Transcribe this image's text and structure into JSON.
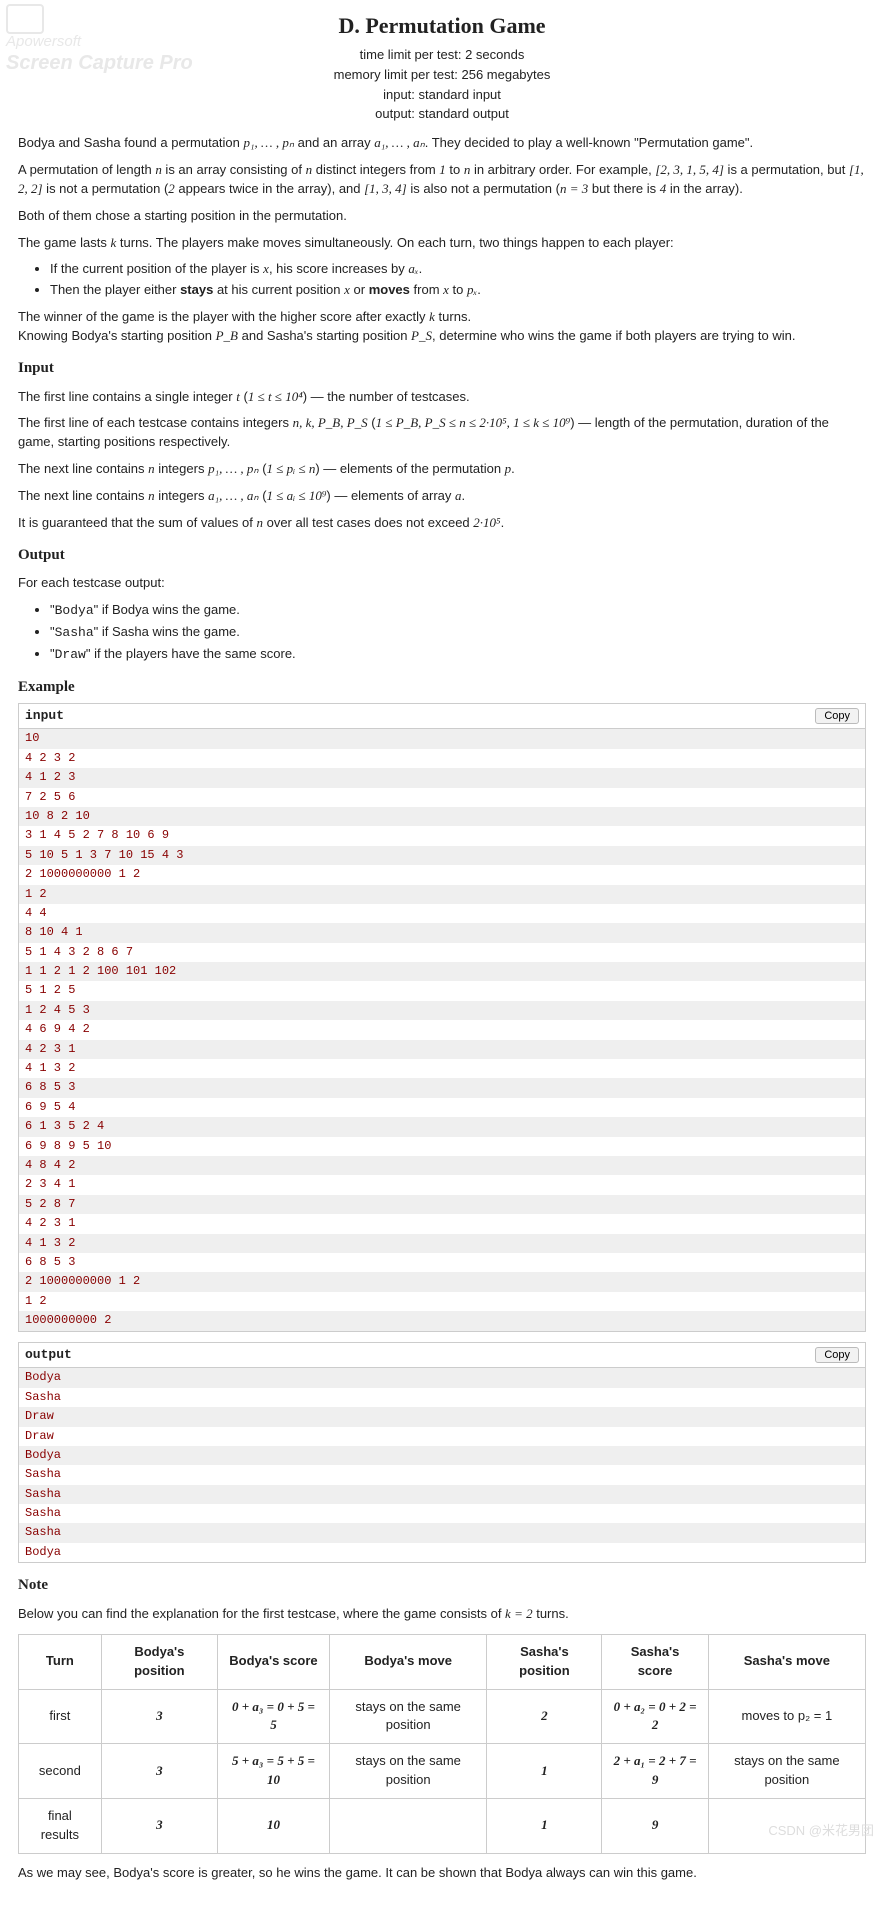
{
  "watermark": {
    "brand": "Apowersoft",
    "product": "Screen Capture Pro"
  },
  "footer": "CSDN @米花男团",
  "title": "D. Permutation Game",
  "meta": {
    "time": "time limit per test: 2 seconds",
    "memory": "memory limit per test: 256 megabytes",
    "input": "input: standard input",
    "output": "output: standard output"
  },
  "body": {
    "p1a": "Bodya and Sasha found a permutation ",
    "p1_m1": "p₁, … , pₙ",
    "p1b": " and an array ",
    "p1_m2": "a₁, … , aₙ",
    "p1c": ". They decided to play a well-known \"Permutation game\".",
    "p2a": "A permutation of length ",
    "p2_n": "n",
    "p2b": " is an array consisting of ",
    "p2_n2": "n",
    "p2c": " distinct integers from ",
    "p2_one": "1",
    "p2d": " to ",
    "p2_n3": "n",
    "p2e": " in arbitrary order. For example, ",
    "p2_ex1": "[2, 3, 1, 5, 4]",
    "p2f": " is a permutation, but ",
    "p2_ex2": "[1, 2, 2]",
    "p2g": " is not a permutation (",
    "p2_two": "2",
    "p2h": " appears twice in the array), and ",
    "p2_ex3": "[1, 3, 4]",
    "p2i": " is also not a permutation (",
    "p2_neq": "n = 3",
    "p2j": " but there is ",
    "p2_four": "4",
    "p2k": " in the array).",
    "p3": "Both of them chose a starting position in the permutation.",
    "p4a": "The game lasts ",
    "p4_k": "k",
    "p4b": " turns. The players make moves simultaneously. On each turn, two things happen to each player:",
    "li1a": "If the current position of the player is ",
    "li1_x": "x",
    "li1b": ", his score increases by ",
    "li1_ax": "aₓ",
    "li1c": ".",
    "li2a": "Then the player either ",
    "li2_stays": "stays",
    "li2b": " at his current position ",
    "li2_x": "x",
    "li2c": " or ",
    "li2_moves": "moves",
    "li2d": " from ",
    "li2_x2": "x",
    "li2e": " to ",
    "li2_px": "pₓ",
    "li2f": ".",
    "p5a": "The winner of the game is the player with the higher score after exactly ",
    "p5_k": "k",
    "p5b": " turns.",
    "p6a": "Knowing Bodya's starting position ",
    "p6_pb": "P_B",
    "p6b": " and Sasha's starting position ",
    "p6_ps": "P_S",
    "p6c": ", determine who wins the game if both players are trying to win."
  },
  "input_h": "Input",
  "input": {
    "p1a": "The first line contains a single integer ",
    "p1_t": "t",
    "p1b": " (",
    "p1_tr": "1 ≤ t ≤ 10⁴",
    "p1c": ") — the number of testcases.",
    "p2a": "The first line of each testcase contains integers ",
    "p2_v": "n, k, P_B, P_S",
    "p2b": " (",
    "p2_r": "1 ≤ P_B, P_S ≤ n ≤ 2·10⁵, 1 ≤ k ≤ 10⁹",
    "p2c": ") — length of the permutation, duration of the game, starting positions respectively.",
    "p3a": "The next line contains ",
    "p3_n": "n",
    "p3b": " integers ",
    "p3_p": "p₁, … , pₙ",
    "p3c": " (",
    "p3_r": "1 ≤ pᵢ ≤ n",
    "p3d": ") — elements of the permutation ",
    "p3_pp": "p",
    "p3e": ".",
    "p4a": "The next line contains ",
    "p4_n": "n",
    "p4b": " integers ",
    "p4_a": "a₁, … , aₙ",
    "p4c": " (",
    "p4_r": "1 ≤ aᵢ ≤ 10⁹",
    "p4d": ") — elements of array ",
    "p4_aa": "a",
    "p4e": ".",
    "p5a": "It is guaranteed that the sum of values of ",
    "p5_n": "n",
    "p5b": " over all test cases does not exceed ",
    "p5_r": "2·10⁵",
    "p5c": "."
  },
  "output_h": "Output",
  "output": {
    "p1": "For each testcase output:",
    "li1a": "\"",
    "li1_tt": "Bodya",
    "li1b": "\" if Bodya wins the game.",
    "li2a": "\"",
    "li2_tt": "Sasha",
    "li2b": "\" if Sasha wins the game.",
    "li3a": "\"",
    "li3_tt": "Draw",
    "li3b": "\" if the players have the same score."
  },
  "example_h": "Example",
  "sample": {
    "input_label": "input",
    "output_label": "output",
    "copy": "Copy",
    "input_lines": [
      "10",
      "4 2 3 2",
      "4 1 2 3",
      "7 2 5 6",
      "10 8 2 10",
      "3 1 4 5 2 7 8 10 6 9",
      "5 10 5 1 3 7 10 15 4 3",
      "2 1000000000 1 2",
      "1 2",
      "4 4",
      "8 10 4 1",
      "5 1 4 3 2 8 6 7",
      "1 1 2 1 2 100 101 102",
      "5 1 2 5",
      "1 2 4 5 3",
      "4 6 9 4 2",
      "4 2 3 1",
      "4 1 3 2",
      "6 8 5 3",
      "6 9 5 4",
      "6 1 3 5 2 4",
      "6 9 8 9 5 10",
      "4 8 4 2",
      "2 3 4 1",
      "5 2 8 7",
      "4 2 3 1",
      "4 1 3 2",
      "6 8 5 3",
      "2 1000000000 1 2",
      "1 2",
      "1000000000 2"
    ],
    "output_lines": [
      "Bodya",
      "Sasha",
      "Draw",
      "Draw",
      "Bodya",
      "Sasha",
      "Sasha",
      "Sasha",
      "Sasha",
      "Bodya"
    ]
  },
  "note_h": "Note",
  "note": {
    "p1a": "Below you can find the explanation for the first testcase, where the game consists of ",
    "p1_k": "k = 2",
    "p1b": " turns.",
    "cols": [
      "Turn",
      "Bodya's position",
      "Bodya's score",
      "Bodya's move",
      "Sasha's position",
      "Sasha's score",
      "Sasha's move"
    ],
    "rows": [
      [
        "first",
        "3",
        "0 + a₃ = 0 + 5 = 5",
        "stays on the same position",
        "2",
        "0 + a₂ = 0 + 2 = 2",
        "moves to p₂ = 1"
      ],
      [
        "second",
        "3",
        "5 + a₃ = 5 + 5 = 10",
        "stays on the same position",
        "1",
        "2 + a₁ = 2 + 7 = 9",
        "stays on the same position"
      ],
      [
        "final results",
        "3",
        "10",
        "",
        "1",
        "9",
        ""
      ]
    ],
    "p2": "As we may see, Bodya's score is greater, so he wins the game. It can be shown that Bodya always can win this game."
  }
}
